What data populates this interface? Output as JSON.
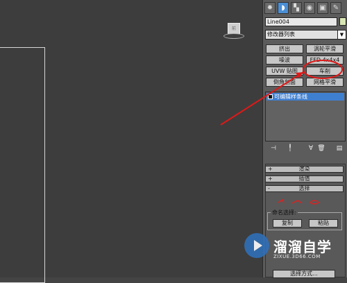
{
  "viewport": {
    "viewcube_label": "前"
  },
  "toolbar": {
    "icons": [
      "sun-icon",
      "modify-icon",
      "hierarchy-icon",
      "motion-icon",
      "display-icon",
      "utilities-icon"
    ]
  },
  "object": {
    "name": "Line004",
    "color": "#d8e6b4"
  },
  "modifier_list": {
    "label": "修改器列表"
  },
  "modifier_buttons": [
    "挤出",
    "涡轮平滑",
    "噪波",
    "FFD 4x4x4",
    "UVW 贴图",
    "车削",
    "倒角剖面",
    "网格平滑"
  ],
  "stack": {
    "items": [
      "可编辑样条线"
    ]
  },
  "rollouts": [
    {
      "sign": "+",
      "label": "渲染"
    },
    {
      "sign": "+",
      "label": "插值"
    },
    {
      "sign": "-",
      "label": "选择"
    }
  ],
  "selection": {
    "named_sel_label": "命名选择:",
    "copy_label": "复制",
    "paste_label": "粘贴",
    "lock_handles_label": "选择方式..."
  },
  "watermark": {
    "title": "溜溜自学",
    "url": "ZIXUE.3D66.COM"
  },
  "annotation": {
    "highlight_color": "#e01818"
  }
}
